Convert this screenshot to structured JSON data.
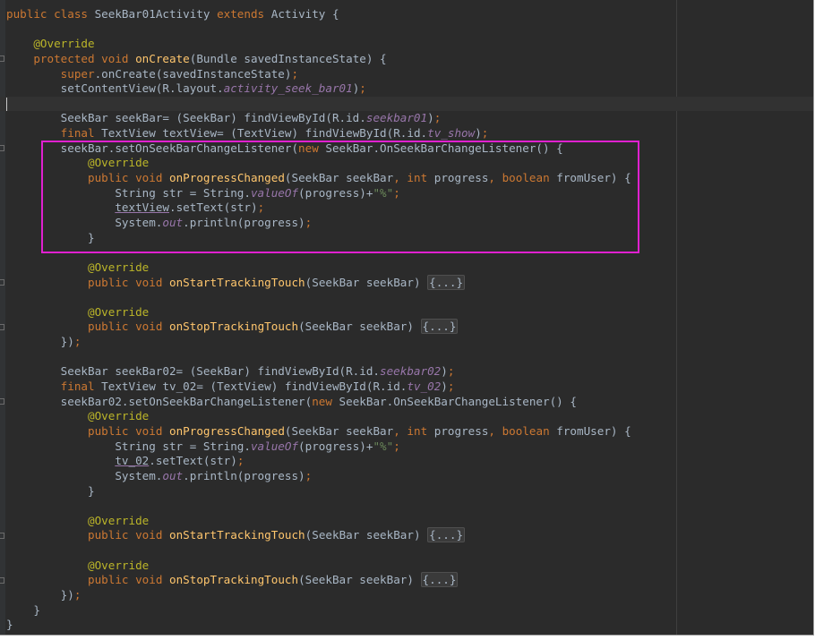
{
  "editor": {
    "highlight_color": "#e020d0",
    "background_color": "#2b2b2b",
    "fold_placeholder_icon": "code-fold-ellipsis"
  },
  "code_lines": [
    [
      [
        "kw",
        "public class "
      ],
      [
        "t",
        "SeekBar01Activity "
      ],
      [
        "kw",
        "extends "
      ],
      [
        "t",
        "Activity {"
      ]
    ],
    [],
    [
      [
        "t",
        "    "
      ],
      [
        "an",
        "@Override"
      ]
    ],
    [
      [
        "t",
        "    "
      ],
      [
        "kw",
        "protected void "
      ],
      [
        "fn",
        "onCreate"
      ],
      [
        "t",
        "(Bundle savedInstanceState) {"
      ]
    ],
    [
      [
        "t",
        "        "
      ],
      [
        "kw",
        "super"
      ],
      [
        "t",
        ".onCreate(savedInstanceState)"
      ],
      [
        "sm",
        ";"
      ]
    ],
    [
      [
        "t",
        "        setContentView(R.layout."
      ],
      [
        "fi",
        "activity_seek_bar01"
      ],
      [
        "t",
        ")"
      ],
      [
        "sm",
        ";"
      ]
    ],
    [],
    [
      [
        "t",
        "        SeekBar seekBar= (SeekBar) findViewById(R.id."
      ],
      [
        "fi",
        "seekbar01"
      ],
      [
        "t",
        ")"
      ],
      [
        "sm",
        ";"
      ]
    ],
    [
      [
        "t",
        "        "
      ],
      [
        "kw",
        "final "
      ],
      [
        "t",
        "TextView textView= (TextView) findViewById(R.id."
      ],
      [
        "fi",
        "tv_show"
      ],
      [
        "t",
        ")"
      ],
      [
        "sm",
        ";"
      ]
    ],
    [
      [
        "t",
        "        seekBar.setOnSeekBarChangeListener("
      ],
      [
        "kw",
        "new "
      ],
      [
        "t",
        "SeekBar.OnSeekBarChangeListener() {"
      ]
    ],
    [
      [
        "t",
        "            "
      ],
      [
        "an",
        "@Override"
      ]
    ],
    [
      [
        "t",
        "            "
      ],
      [
        "kw",
        "public void "
      ],
      [
        "fn",
        "onProgressChanged"
      ],
      [
        "t",
        "(SeekBar seekBar"
      ],
      [
        "sm",
        ", "
      ],
      [
        "kw",
        "int "
      ],
      [
        "t",
        "progress"
      ],
      [
        "sm",
        ", "
      ],
      [
        "kw",
        "boolean "
      ],
      [
        "t",
        "fromUser) {"
      ]
    ],
    [
      [
        "t",
        "                String str = String."
      ],
      [
        "fi",
        "valueOf"
      ],
      [
        "t",
        "(progress)+"
      ],
      [
        "st",
        "\"%\""
      ],
      [
        "sm",
        ";"
      ]
    ],
    [
      [
        "t",
        "                "
      ],
      [
        "ul",
        "textView"
      ],
      [
        "t",
        ".setText(str)"
      ],
      [
        "sm",
        ";"
      ]
    ],
    [
      [
        "t",
        "                System."
      ],
      [
        "fi",
        "out"
      ],
      [
        "t",
        ".println(progress)"
      ],
      [
        "sm",
        ";"
      ]
    ],
    [
      [
        "t",
        "            }"
      ]
    ],
    [],
    [
      [
        "t",
        "            "
      ],
      [
        "an",
        "@Override"
      ]
    ],
    [
      [
        "t",
        "            "
      ],
      [
        "kw",
        "public void "
      ],
      [
        "fn",
        "onStartTrackingTouch"
      ],
      [
        "t",
        "(SeekBar seekBar) "
      ],
      [
        "fo",
        "{...}"
      ]
    ],
    [],
    [
      [
        "t",
        "            "
      ],
      [
        "an",
        "@Override"
      ]
    ],
    [
      [
        "t",
        "            "
      ],
      [
        "kw",
        "public void "
      ],
      [
        "fn",
        "onStopTrackingTouch"
      ],
      [
        "t",
        "(SeekBar seekBar) "
      ],
      [
        "fo",
        "{...}"
      ]
    ],
    [
      [
        "t",
        "        })"
      ],
      [
        "sm",
        ";"
      ]
    ],
    [],
    [
      [
        "t",
        "        SeekBar seekBar02= (SeekBar) findViewById(R.id."
      ],
      [
        "fi",
        "seekbar02"
      ],
      [
        "t",
        ")"
      ],
      [
        "sm",
        ";"
      ]
    ],
    [
      [
        "t",
        "        "
      ],
      [
        "kw",
        "final "
      ],
      [
        "t",
        "TextView tv_02= (TextView) findViewById(R.id."
      ],
      [
        "fi",
        "tv_02"
      ],
      [
        "t",
        ")"
      ],
      [
        "sm",
        ";"
      ]
    ],
    [
      [
        "t",
        "        seekBar02.setOnSeekBarChangeListener("
      ],
      [
        "kw",
        "new "
      ],
      [
        "t",
        "SeekBar.OnSeekBarChangeListener() {"
      ]
    ],
    [
      [
        "t",
        "            "
      ],
      [
        "an",
        "@Override"
      ]
    ],
    [
      [
        "t",
        "            "
      ],
      [
        "kw",
        "public void "
      ],
      [
        "fn",
        "onProgressChanged"
      ],
      [
        "t",
        "(SeekBar seekBar"
      ],
      [
        "sm",
        ", "
      ],
      [
        "kw",
        "int "
      ],
      [
        "t",
        "progress"
      ],
      [
        "sm",
        ", "
      ],
      [
        "kw",
        "boolean "
      ],
      [
        "t",
        "fromUser) {"
      ]
    ],
    [
      [
        "t",
        "                String str = String."
      ],
      [
        "fi",
        "valueOf"
      ],
      [
        "t",
        "(progress)+"
      ],
      [
        "st",
        "\"%\""
      ],
      [
        "sm",
        ";"
      ]
    ],
    [
      [
        "t",
        "                "
      ],
      [
        "ul",
        "tv_02"
      ],
      [
        "t",
        ".setText(str)"
      ],
      [
        "sm",
        ";"
      ]
    ],
    [
      [
        "t",
        "                System."
      ],
      [
        "fi",
        "out"
      ],
      [
        "t",
        ".println(progress)"
      ],
      [
        "sm",
        ";"
      ]
    ],
    [
      [
        "t",
        "            }"
      ]
    ],
    [],
    [
      [
        "t",
        "            "
      ],
      [
        "an",
        "@Override"
      ]
    ],
    [
      [
        "t",
        "            "
      ],
      [
        "kw",
        "public void "
      ],
      [
        "fn",
        "onStartTrackingTouch"
      ],
      [
        "t",
        "(SeekBar seekBar) "
      ],
      [
        "fo",
        "{...}"
      ]
    ],
    [],
    [
      [
        "t",
        "            "
      ],
      [
        "an",
        "@Override"
      ]
    ],
    [
      [
        "t",
        "            "
      ],
      [
        "kw",
        "public void "
      ],
      [
        "fn",
        "onStopTrackingTouch"
      ],
      [
        "t",
        "(SeekBar seekBar) "
      ],
      [
        "fo",
        "{...}"
      ]
    ],
    [
      [
        "t",
        "        })"
      ],
      [
        "sm",
        ";"
      ]
    ],
    [
      [
        "t",
        "    }"
      ]
    ],
    [
      [
        "t",
        "}"
      ]
    ]
  ]
}
